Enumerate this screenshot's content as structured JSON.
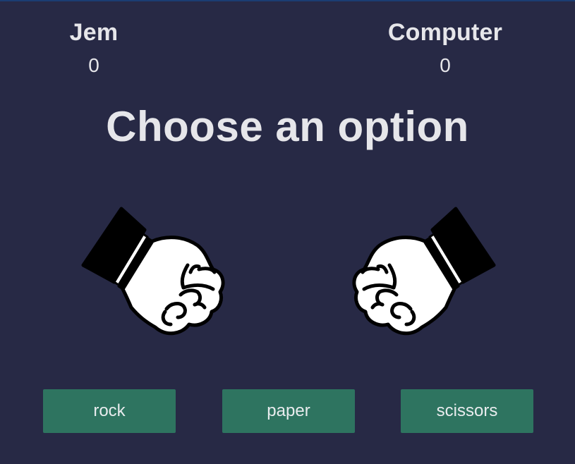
{
  "scoreboard": {
    "player": {
      "name": "Jem",
      "score": "0"
    },
    "computer": {
      "name": "Computer",
      "score": "0"
    }
  },
  "message": "Choose an option",
  "hands": {
    "player": "fist-icon",
    "computer": "fist-icon"
  },
  "choices": [
    {
      "label": "rock"
    },
    {
      "label": "paper"
    },
    {
      "label": "scissors"
    }
  ],
  "colors": {
    "background": "#272945",
    "button": "#2e7460",
    "text": "#e6e6ea"
  }
}
